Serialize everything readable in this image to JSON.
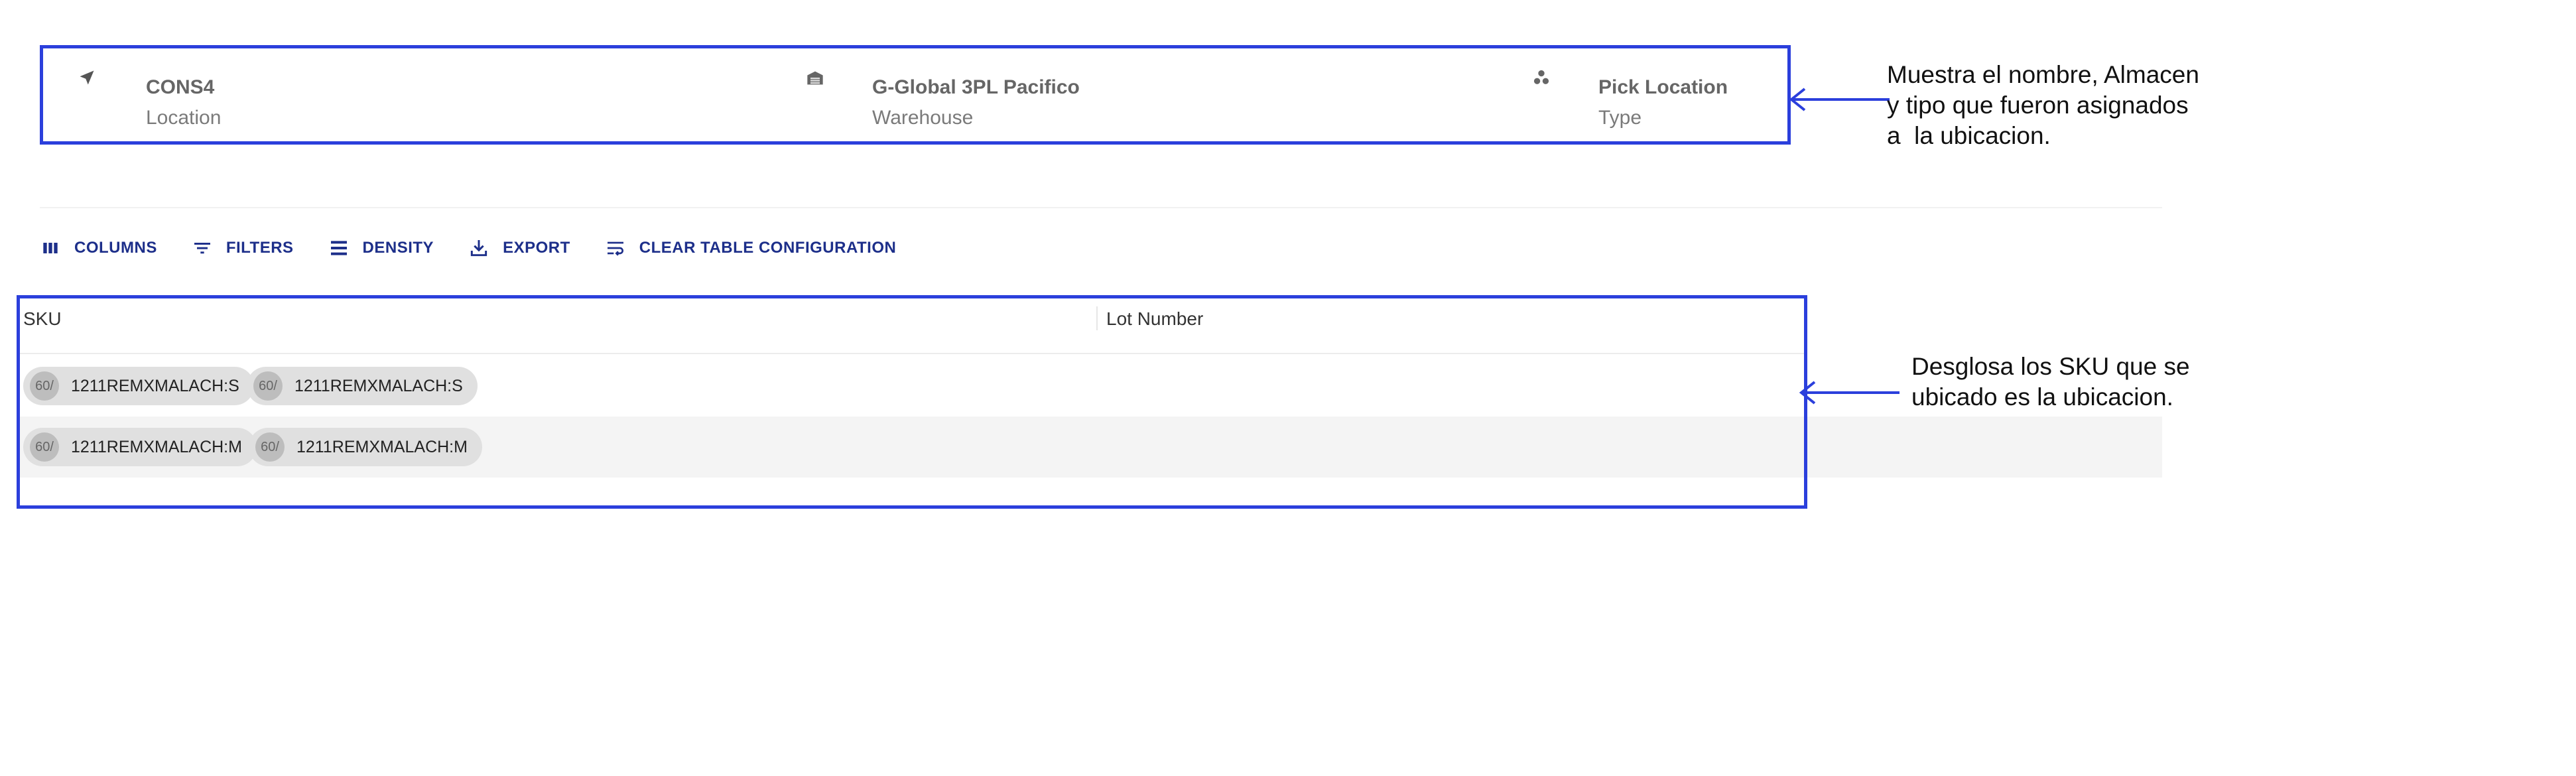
{
  "location": {
    "name": "CONS4",
    "name_label": "Location",
    "warehouse": "G-Global 3PL Pacifico",
    "warehouse_label": "Warehouse",
    "type": "Pick Location",
    "type_label": "Type"
  },
  "annotations": {
    "info": [
      "Muestra el nombre, Almacen",
      "y tipo que fueron asignados",
      "a  la ubicacion."
    ],
    "grid": [
      "Desglosa los SKU que se",
      "ubicado es la ubicacion."
    ]
  },
  "toolbar": {
    "columns": "COLUMNS",
    "filters": "FILTERS",
    "density": "DENSITY",
    "export": "EXPORT",
    "clear": "CLEAR TABLE CONFIGURATION"
  },
  "table": {
    "columns": [
      "SKU",
      "Lot Number"
    ],
    "rows": [
      {
        "chips": [
          {
            "avatar": "60/",
            "label": "1211REMXMALACH:S"
          },
          {
            "avatar": "60/",
            "label": "1211REMXMALACH:S"
          }
        ],
        "lot": ""
      },
      {
        "chips": [
          {
            "avatar": "60/",
            "label": "1211REMXMALACH:M"
          },
          {
            "avatar": "60/",
            "label": "1211REMXMALACH:M"
          }
        ],
        "lot": ""
      }
    ]
  },
  "colors": {
    "annotation_outline": "#2b3fdc",
    "toolbar_text": "#1d2f8a"
  },
  "icons": {
    "location": "navigation-arrow-icon",
    "warehouse": "warehouse-icon",
    "type": "category-icon",
    "columns": "view-column-icon",
    "filters": "filter-list-icon",
    "density": "density-icon",
    "export": "download-icon",
    "clear": "wrap-text-icon"
  }
}
